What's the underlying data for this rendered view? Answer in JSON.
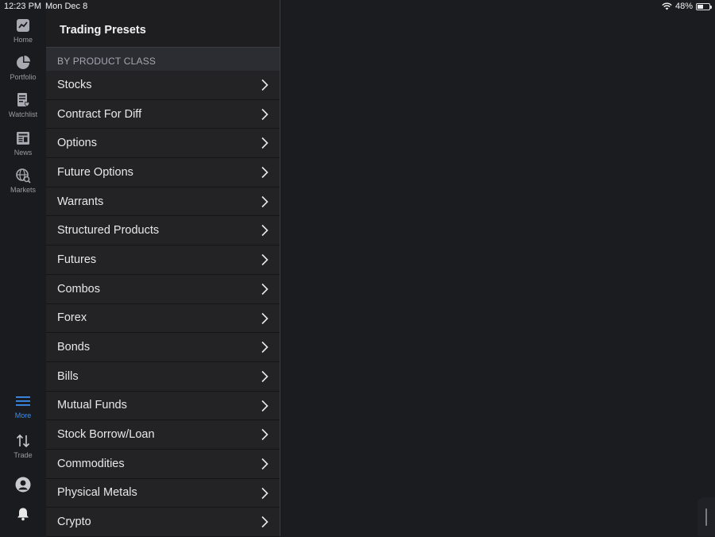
{
  "status": {
    "time": "12:23 PM",
    "date": "Mon Dec 8",
    "battery": "48%",
    "battery_level": 0.48
  },
  "rail": {
    "home": "Home",
    "portfolio": "Portfolio",
    "watchlist": "Watchlist",
    "news": "News",
    "markets": "Markets",
    "more": "More",
    "trade": "Trade"
  },
  "panel": {
    "title": "Trading Presets",
    "section": "BY PRODUCT CLASS",
    "items": [
      {
        "label": "Stocks"
      },
      {
        "label": "Contract For Diff"
      },
      {
        "label": "Options"
      },
      {
        "label": "Future Options"
      },
      {
        "label": "Warrants"
      },
      {
        "label": "Structured Products"
      },
      {
        "label": "Futures"
      },
      {
        "label": "Combos"
      },
      {
        "label": "Forex"
      },
      {
        "label": "Bonds"
      },
      {
        "label": "Bills"
      },
      {
        "label": "Mutual Funds"
      },
      {
        "label": "Stock Borrow/Loan"
      },
      {
        "label": "Commodities"
      },
      {
        "label": "Physical Metals"
      },
      {
        "label": "Crypto"
      }
    ]
  },
  "colors": {
    "accent": "#3d8ef0",
    "background": "#1b1c20"
  }
}
